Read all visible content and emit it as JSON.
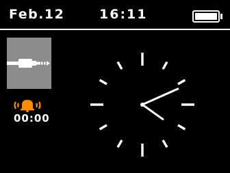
{
  "status": {
    "date": "Feb.12",
    "time": "16:11",
    "battery_icon": "battery-full-icon"
  },
  "source": {
    "icon": "aux-cable-icon",
    "background": "#8c8c8c"
  },
  "alarm": {
    "icon": "alarm-bell-icon",
    "color": "#ff8c00",
    "time": "00:00"
  },
  "clock": {
    "hours": 16,
    "minutes": 11
  }
}
